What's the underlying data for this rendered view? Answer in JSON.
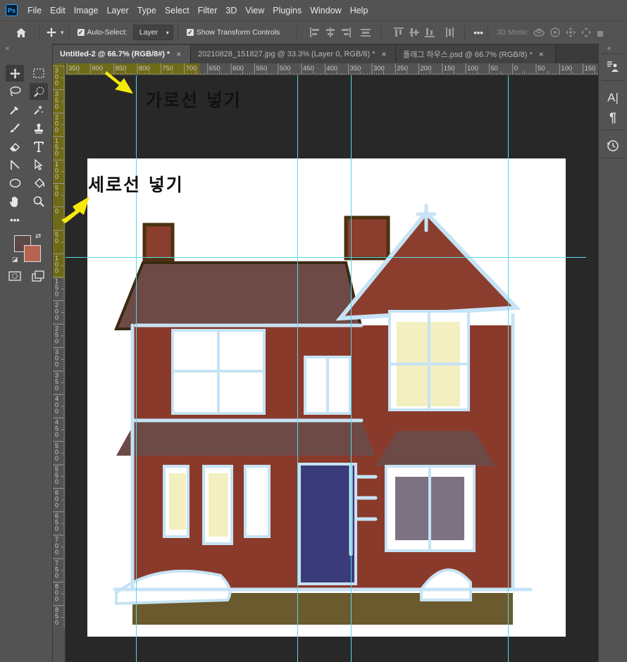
{
  "app": {
    "logo": "Ps"
  },
  "menu": [
    "File",
    "Edit",
    "Image",
    "Layer",
    "Type",
    "Select",
    "Filter",
    "3D",
    "View",
    "Plugins",
    "Window",
    "Help"
  ],
  "options": {
    "auto_select_label": "Auto-Select:",
    "auto_select_checked": true,
    "layer_select_value": "Layer",
    "show_transform_label": "Show Transform Controls",
    "show_transform_checked": true,
    "more_label": "•••",
    "mode_3d_label": "3D Mode:"
  },
  "tabs": [
    {
      "label": "Untitled-2 @ 66.7% (RGB/8#) *",
      "close": "×",
      "active": true
    },
    {
      "label": "20210828_151827.jpg @ 33.3% (Layer 0, RGB/8) *",
      "close": "×",
      "active": false
    },
    {
      "label": "플래그 하우스.psd @ 66.7% (RGB/8) *",
      "close": "×",
      "active": false
    }
  ],
  "ruler_h": [
    "350",
    "900",
    "850",
    "800",
    "750",
    "700",
    "650",
    "600",
    "550",
    "500",
    "450",
    "400",
    "350",
    "300",
    "250",
    "200",
    "150",
    "100",
    "50",
    "0",
    "50",
    "100",
    "150"
  ],
  "ruler_v": [
    "300",
    "350",
    "200",
    "150",
    "100",
    "50",
    "0",
    "50",
    "100",
    "150",
    "200",
    "250",
    "300",
    "350",
    "400",
    "450",
    "500",
    "550",
    "600",
    "650",
    "700",
    "750",
    "800",
    "850"
  ],
  "annotations": {
    "horizontal_guide": "가로선 넣기",
    "vertical_guide": "세로선 넣기"
  },
  "colors": {
    "foreground": "#5c4844",
    "background": "#b7634f",
    "guide": "#57d9e6",
    "ruler_highlight": "#6f6a17",
    "arrow": "#f5e90c"
  },
  "collapse": {
    "left": "«",
    "right": "«"
  },
  "icons": {
    "options": [
      "home-icon",
      "move-icon"
    ],
    "tools": [
      "move-tool-icon",
      "marquee-tool-icon",
      "lasso-tool-icon",
      "quick-select-tool-icon",
      "eyedropper-tool-icon",
      "healing-brush-tool-icon",
      "brush-tool-icon",
      "stamp-tool-icon",
      "eraser-tool-icon",
      "type-tool-icon",
      "path-select-tool-icon",
      "direct-select-tool-icon",
      "ellipse-tool-icon",
      "paint-bucket-tool-icon",
      "hand-tool-icon",
      "zoom-tool-icon",
      "more-tools-icon"
    ],
    "right_panel": [
      "properties-icon",
      "character-icon",
      "paragraph-icon",
      "history-icon"
    ]
  }
}
